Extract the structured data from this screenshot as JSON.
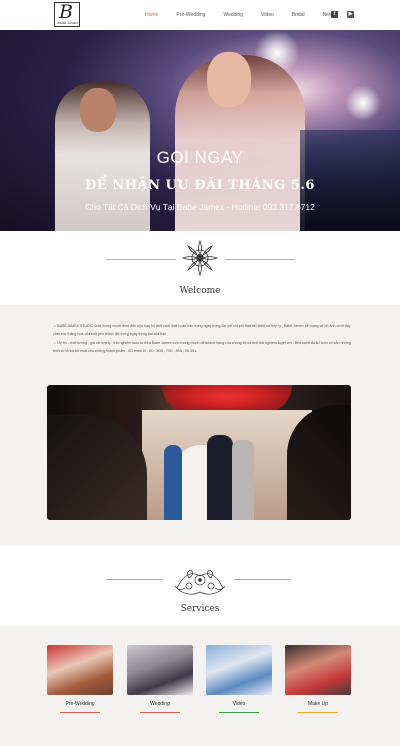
{
  "header": {
    "logo": {
      "letter": "B",
      "subtext": "BABE JAMEX"
    },
    "nav": [
      "Home",
      "Pre-Wedding",
      "Wedding",
      "Video",
      "Bridal",
      "News"
    ],
    "active_nav": "Home",
    "social": [
      "facebook-icon",
      "youtube-icon"
    ]
  },
  "hero": {
    "title": "GỌI NGAY",
    "promo": "ĐỂ NHẬN ƯU ĐÃI THÁNG 5.6",
    "subtitle": "Cho Tất Cả Dịch Vụ Tại Babe Jamex - Hotline: 093.317.6712"
  },
  "welcome": {
    "title": "Welcome",
    "paragraphs": [
      "☼ BABEJAMEX STUDIO luôn mong muốn đem đến cho bạn bộ ảnh cưới thật hoàn hảo trong ngày trọng đại với chi phí thật tiết kiệm và hợp lý . Babe Jamex sẽ mang về bộ ảnh cưới đầy cảm xúc thăng hoa của tình yêu mãnh liệt trong ngày trọng đại của bạn .",
      "☼ Uy tín , chất lượng , giá cả hợp lý , trải nghiệm luôn là điều Babe Jamex luôn mong muốn để khách hàng của chúng tôi có một trải nghiệm tuyệt vời . Bên cạnh đó BJ luôn có sẵn những thiết bị hỗ trợ tốt nhất cho những thành phẩm : 5D mark III , 6D , 80D , 70D , 85A , 35-35 L"
    ]
  },
  "services": {
    "title": "Services",
    "items": [
      {
        "label": "Pre-Wedding",
        "color": "#e05a5a"
      },
      {
        "label": "Wedding",
        "color": "#e05a5a"
      },
      {
        "label": "Video",
        "color": "#3aa04f"
      },
      {
        "label": "Make Up",
        "color": "#f0a030"
      }
    ]
  },
  "colors": {
    "accent": "#e05a5a",
    "divider_blue": "#9ab6d8",
    "divider_green": "#7cc48a",
    "divider_red": "#e88080"
  }
}
